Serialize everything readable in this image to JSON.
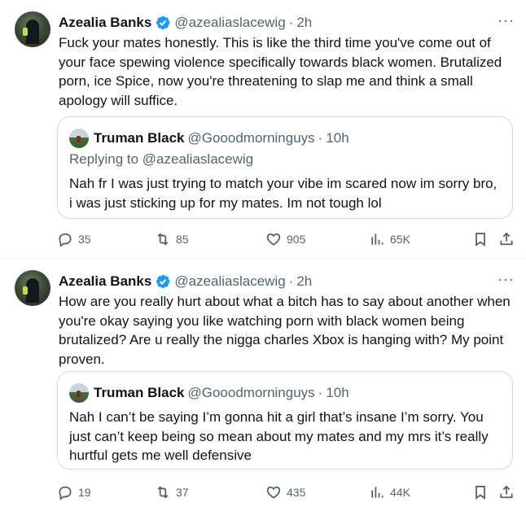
{
  "tweets": [
    {
      "author": {
        "name": "Azealia Banks",
        "handle": "@azealiaslacewig",
        "time": "2h"
      },
      "text": "Fuck your mates honestly. This is like the third time you've come out of your face spewing violence specifically towards black women. Brutalized porn, ice Spice, now you're threatening to slap me and think a small apology will suffice.",
      "quote": {
        "name": "Truman Black",
        "handle": "@Gooodmorninguys",
        "time": "10h",
        "replying_prefix": "Replying to ",
        "replying_to": "@azealiaslacewig",
        "text": "Nah fr I was just trying to match your vibe im scared now im sorry bro, i was just sticking up for my mates. Im not tough lol"
      },
      "stats": {
        "replies": "35",
        "retweets": "85",
        "likes": "905",
        "views": "65K"
      }
    },
    {
      "author": {
        "name": "Azealia Banks",
        "handle": "@azealiaslacewig",
        "time": "2h"
      },
      "text": "How are you really hurt about what a bitch has to say about another when you're okay saying you like watching porn with black women being brutalized? Are u really the nigga charles Xbox is hanging with? My point proven.",
      "quote": {
        "name": "Truman Black",
        "handle": "@Gooodmorninguys",
        "time": "10h",
        "text": "Nah I can’t be saying I’m gonna hit a girl that’s insane I’m sorry. You just can’t keep being so mean about my mates and my mrs it’s really hurtful gets me well defensive"
      },
      "stats": {
        "replies": "19",
        "retweets": "37",
        "likes": "435",
        "views": "44K"
      }
    }
  ],
  "ui": {
    "dot": "·",
    "more": "···"
  },
  "icons": [
    "verified-badge-icon",
    "reply-icon",
    "retweet-icon",
    "like-icon",
    "views-icon",
    "bookmark-icon",
    "share-icon"
  ],
  "colors": {
    "verified": "#1d9bf0",
    "secondary_text": "#536471",
    "border": "#cfd9de"
  }
}
